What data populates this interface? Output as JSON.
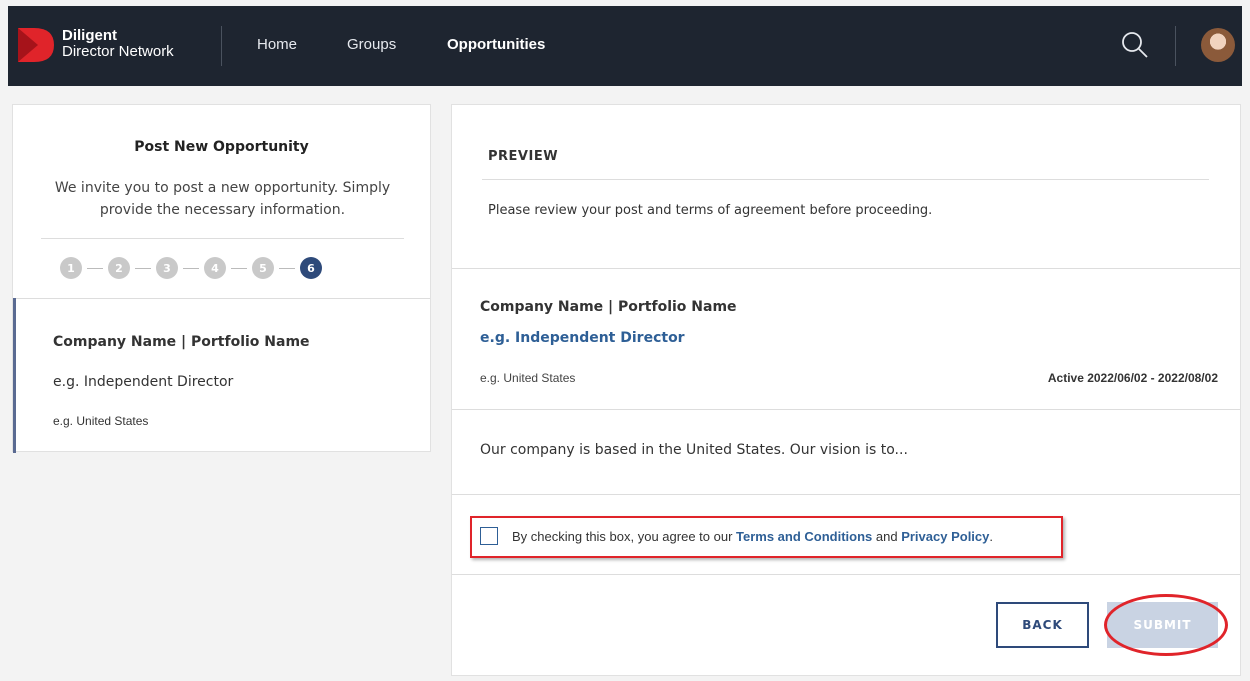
{
  "header": {
    "brand_line1": "Diligent",
    "brand_line2": "Director Network",
    "nav": [
      {
        "label": "Home",
        "active": false
      },
      {
        "label": "Groups",
        "active": false
      },
      {
        "label": "Opportunities",
        "active": true
      }
    ],
    "search_icon": "search-icon",
    "avatar_icon": "user-avatar"
  },
  "left_panel": {
    "title": "Post New Opportunity",
    "description": "We invite you to post a new opportunity. Simply provide the necessary information.",
    "steps": [
      "1",
      "2",
      "3",
      "4",
      "5",
      "6"
    ],
    "active_step": 6,
    "company": "Company Name | Portfolio Name",
    "role": "e.g. Independent Director",
    "location": "e.g. United States"
  },
  "preview": {
    "heading": "PREVIEW",
    "review_text": "Please review your post and terms of agreement before proceeding.",
    "company": "Company Name | Portfolio Name",
    "role": "e.g. Independent Director",
    "location": "e.g. United States",
    "dates": "Active 2022/06/02 - 2022/08/02",
    "description": "Our company is based in the United States. Our vision is to...",
    "agreement": {
      "prefix": "By checking this box, you agree to our ",
      "terms_link": "Terms and Conditions",
      "middle": " and ",
      "privacy_link": "Privacy Policy",
      "suffix": ".",
      "checked": false
    },
    "back_label": "BACK",
    "submit_label": "SUBMIT"
  },
  "colors": {
    "nav_bg": "#1e2530",
    "accent": "#2e4a7a",
    "link": "#2e5f96",
    "highlight": "#e0242a",
    "logo": "#e0242a"
  }
}
